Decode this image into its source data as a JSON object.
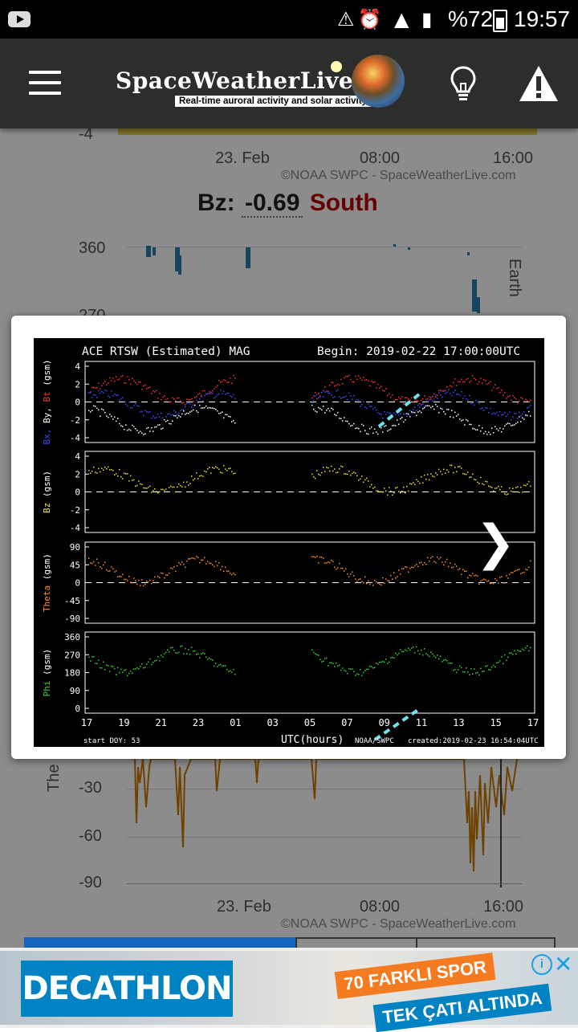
{
  "status_bar": {
    "battery": "%72",
    "time": "19:57"
  },
  "app_bar": {
    "logo": "SpaceWeatherLive",
    "tagline": "Real-time auroral activity and solar activity"
  },
  "background": {
    "top_chart": {
      "ytick": "-4",
      "xticks": [
        "23. Feb",
        "08:00",
        "16:00"
      ],
      "credit": "©NOAA SWPC - SpaceWeatherLive.com"
    },
    "bz_readout": {
      "label": "Bz:",
      "value": "-0.69",
      "direction": "South"
    },
    "phi_chart": {
      "yticks": [
        "360",
        "270"
      ],
      "earth_label": "Earth"
    },
    "theta_chart": {
      "ylabel": "The",
      "yticks": [
        "-30",
        "-60",
        "-90"
      ],
      "xticks": [
        "23. Feb",
        "08:00",
        "16:00"
      ],
      "credit": "©NOAA SWPC - SpaceWeatherLive.com"
    }
  },
  "modal": {
    "title": "ACE RTSW (Estimated) MAG",
    "begin": "Begin: 2019-02-22 17:00:00UTC",
    "panels": [
      {
        "ylabel_parts": [
          "Bx,",
          " By,",
          " Bt",
          " (gsm)"
        ],
        "ylabel_colors": [
          "#3b4dff",
          "#ffffff",
          "#ff3030",
          "#ffffff"
        ],
        "yticks": [
          "4",
          "2",
          "0",
          "-2",
          "-4"
        ]
      },
      {
        "ylabel_parts": [
          "Bz",
          " (gsm)"
        ],
        "ylabel_colors": [
          "#e8e23a",
          "#ffffff"
        ],
        "yticks": [
          "4",
          "2",
          "0",
          "-2",
          "-4"
        ]
      },
      {
        "ylabel_parts": [
          "Theta",
          " (gsm)"
        ],
        "ylabel_colors": [
          "#ff8c2a",
          "#ffffff"
        ],
        "yticks": [
          "90",
          "45",
          "0",
          "-45",
          "-90"
        ]
      },
      {
        "ylabel_parts": [
          "Phi",
          " (gsm)"
        ],
        "ylabel_colors": [
          "#3ad13a",
          "#ffffff"
        ],
        "yticks": [
          "360",
          "270",
          "180",
          "90",
          "0"
        ]
      }
    ],
    "xticks": [
      "17",
      "19",
      "21",
      "23",
      "01",
      "03",
      "05",
      "07",
      "09",
      "11",
      "13",
      "15",
      "17"
    ],
    "xlabel": "UTC(hours)",
    "start_doy": "start DOY:  53",
    "source": "NOAA/SWPC",
    "created": "created:2019-02-23 16:54:04UTC",
    "next_glyph": "❯"
  },
  "ad": {
    "brand": "DECATHLON",
    "slogan_1": "70 FARKLI SPOR",
    "slogan_2": "TEK ÇATI ALTINDA",
    "info": "i",
    "close": "✕"
  }
}
